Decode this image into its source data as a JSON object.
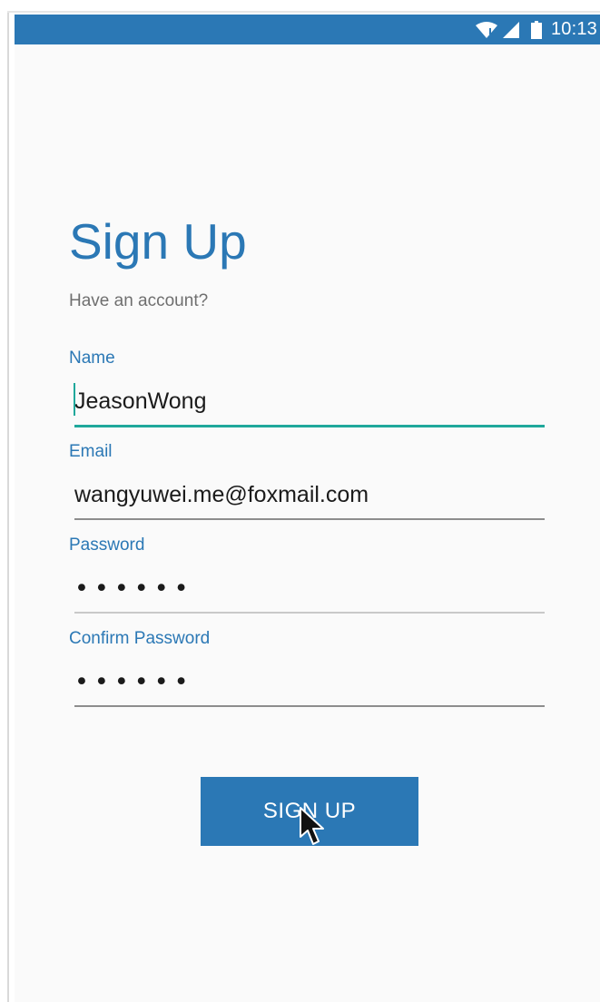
{
  "status_bar": {
    "time": "10:13",
    "icons": [
      "wifi-icon",
      "cellular-signal-icon",
      "battery-icon"
    ]
  },
  "page": {
    "title": "Sign Up",
    "subtitle": "Have an account?"
  },
  "form": {
    "name": {
      "label": "Name",
      "value": "JeasonWong"
    },
    "email": {
      "label": "Email",
      "value": "wangyuwei.me@foxmail.com"
    },
    "password": {
      "label": "Password",
      "value": "••••••"
    },
    "confirm_password": {
      "label": "Confirm Password",
      "value": "••••••"
    }
  },
  "actions": {
    "signup_label": "SIGN UP"
  },
  "colors": {
    "primary": "#2b78b5",
    "accent": "#1fa89b",
    "background": "#fafafa"
  }
}
